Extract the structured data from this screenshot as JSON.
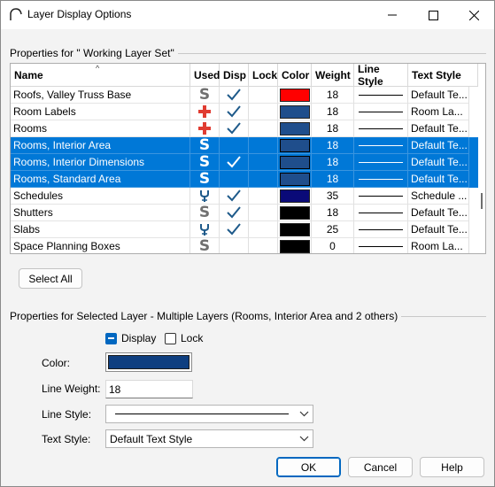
{
  "window": {
    "title": "Layer Display Options"
  },
  "group_top": {
    "label": "Properties for \" Working Layer Set\""
  },
  "table": {
    "columns": [
      "Name",
      "Used",
      "Disp",
      "Lock",
      "Color",
      "Weight",
      "Line Style",
      "Text Style"
    ],
    "rows": [
      {
        "name": "Roofs, Valley Truss Base",
        "used": "S",
        "disp": true,
        "color": "#ff0000",
        "weight": "18",
        "text_style": "Default Te...",
        "selected": false
      },
      {
        "name": "Room Labels",
        "used": "plus",
        "disp": true,
        "color": "#1f4e8c",
        "weight": "18",
        "text_style": "Room La...",
        "selected": false
      },
      {
        "name": "Rooms",
        "used": "plus",
        "disp": true,
        "color": "#1f4e8c",
        "weight": "18",
        "text_style": "Default Te...",
        "selected": false
      },
      {
        "name": "Rooms, Interior Area",
        "used": "S",
        "disp": false,
        "color": "#1f4e8c",
        "weight": "18",
        "text_style": "Default Te...",
        "selected": true
      },
      {
        "name": "Rooms, Interior Dimensions",
        "used": "S",
        "disp": true,
        "color": "#1f4e8c",
        "weight": "18",
        "text_style": "Default Te...",
        "selected": true
      },
      {
        "name": "Rooms, Standard Area",
        "used": "S",
        "disp": false,
        "color": "#1f4e8c",
        "weight": "18",
        "text_style": "Default Te...",
        "selected": true
      },
      {
        "name": "Schedules",
        "used": "anchor",
        "disp": true,
        "color": "#0a0a78",
        "weight": "35",
        "text_style": "Schedule ...",
        "selected": false
      },
      {
        "name": "Shutters",
        "used": "S",
        "disp": true,
        "color": "#000000",
        "weight": "18",
        "text_style": "Default Te...",
        "selected": false
      },
      {
        "name": "Slabs",
        "used": "anchor",
        "disp": true,
        "color": "#000000",
        "weight": "25",
        "text_style": "Default Te...",
        "selected": false
      },
      {
        "name": "Space Planning Boxes",
        "used": "S",
        "disp": false,
        "color": "#000000",
        "weight": "0",
        "text_style": "Room La...",
        "selected": false
      }
    ]
  },
  "select_all": {
    "label": "Select All"
  },
  "group_bottom": {
    "label": "Properties for Selected Layer - Multiple Layers (Rooms, Interior Area and 2 others)"
  },
  "display_check": {
    "label": "Display",
    "state": "indeterminate"
  },
  "lock_check": {
    "label": "Lock",
    "state": "unchecked"
  },
  "color_field": {
    "label": "Color:",
    "value": "#0f3f80"
  },
  "line_weight": {
    "label": "Line Weight:",
    "value": "18"
  },
  "line_style": {
    "label": "Line Style:"
  },
  "text_style": {
    "label": "Text Style:",
    "value": "Default Text Style"
  },
  "buttons": {
    "ok": "OK",
    "cancel": "Cancel",
    "help": "Help"
  },
  "icons": {
    "app": "arch-icon",
    "minimize": "minimize-icon",
    "maximize": "maximize-icon",
    "close": "close-icon",
    "sort": "sort-up-icon",
    "check": "checkmark-icon",
    "used_s": "s-icon",
    "used_plus": "red-plus-icon",
    "used_anchor": "anchor-s-icon"
  },
  "colors": {
    "selection": "#0078d7",
    "check": "#1e5a8a",
    "plus": "#e03c31"
  }
}
